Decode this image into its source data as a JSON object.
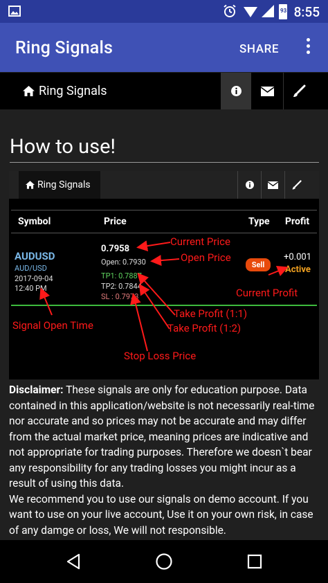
{
  "status_bar": {
    "time": "8:55",
    "battery": "93"
  },
  "appbar": {
    "title": "Ring Signals",
    "share": "SHARE"
  },
  "nav": {
    "brand": "Ring Signals"
  },
  "content": {
    "heading": "How to use!",
    "preview": {
      "brand": "Ring Signals",
      "columns": [
        "Symbol",
        "Price",
        "Type",
        "Profit"
      ],
      "row": {
        "symbol": "AUDUSD",
        "pair": "AUD/USD",
        "date": "2017-09-04",
        "time": "12:40 PM",
        "price": "0.7958",
        "open": "Open: 0.7930",
        "tp1": "TP1: 0.7887",
        "tp2": "TP2: 0.7844",
        "sl": "SL : 0.7973",
        "type": "Sell",
        "profit": "+0.001",
        "status": "Active"
      },
      "annotations": {
        "current_price": "Current Price",
        "open_price": "Open Price",
        "current_profit": "Current Profit",
        "tp1": "Take Profit (1:1)",
        "tp2": "Take Profit (1:2)",
        "open_time": "Signal Open Time",
        "stop_loss": "Stop Loss Price"
      }
    },
    "disclaimer_label": "Disclaimer:",
    "disclaimer_text": " These signals are only for education purpose. Data contained in this application/website is not necessarily real-time nor accurate and so prices may not be accurate and may differ from the actual market price, meaning prices are indicative and not appropriate for trading purposes. Therefore we doesn`t bear any responsibility for any trading losses you might incur as a result of using this data.",
    "recommend_text": "We recommend you to use our signals on demo account. If you want to use on your live account, Use it on your own risk, in case of any damge or loss, We will not responsible."
  },
  "colors": {
    "appbar": "#3f51b5",
    "statusbar": "#2a3a9a",
    "accent_red": "#ff1a1a",
    "green": "#3dbb3d",
    "sell_badge": "#e84a0c"
  }
}
